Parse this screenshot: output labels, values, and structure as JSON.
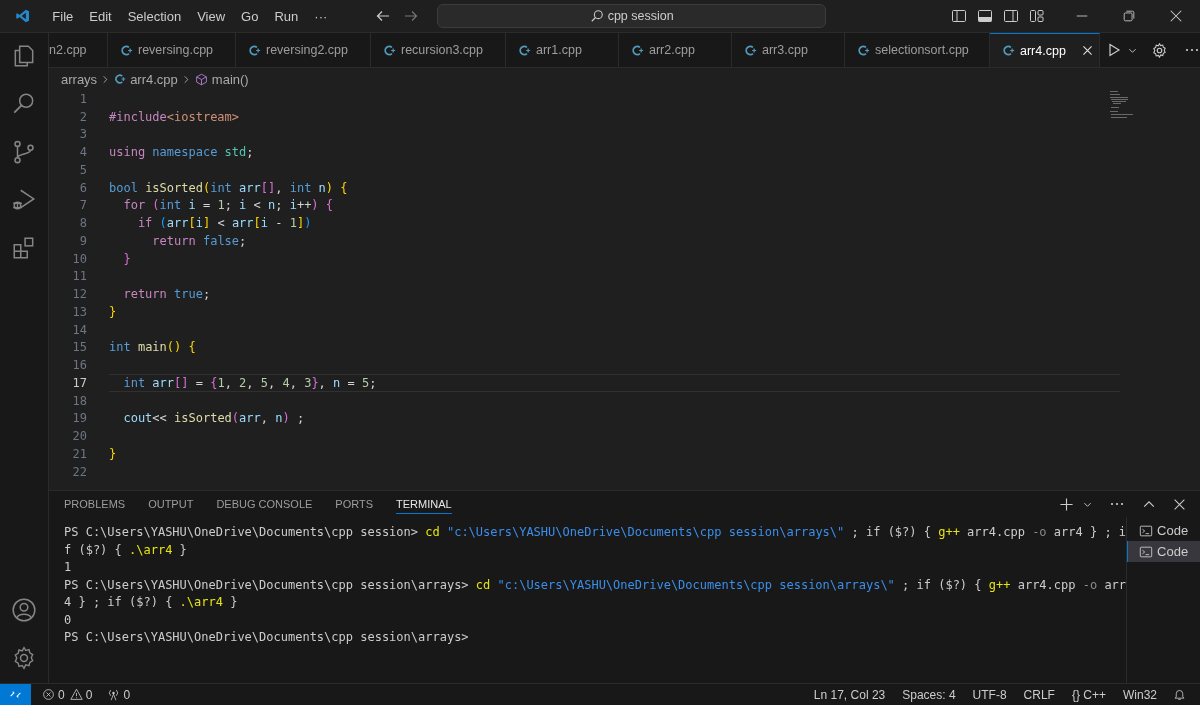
{
  "title_bar": {
    "menu": [
      "File",
      "Edit",
      "Selection",
      "View",
      "Go",
      "Run",
      "···"
    ],
    "search": "cpp session"
  },
  "tabs": [
    {
      "label": "n2.cpp",
      "selected": false
    },
    {
      "label": "reversing.cpp",
      "selected": false
    },
    {
      "label": "reversing2.cpp",
      "selected": false
    },
    {
      "label": "recursion3.cpp",
      "selected": false
    },
    {
      "label": "arr1.cpp",
      "selected": false
    },
    {
      "label": "arr2.cpp",
      "selected": false
    },
    {
      "label": "arr3.cpp",
      "selected": false
    },
    {
      "label": "selectionsort.cpp",
      "selected": false
    },
    {
      "label": "arr4.cpp",
      "selected": true
    }
  ],
  "breadcrumb": [
    "arrays",
    "arr4.cpp",
    "main()"
  ],
  "code_lines": [
    {
      "number": "1"
    },
    {
      "number": "2",
      "tokens": [
        {
          "text": "#include",
          "kind": "keyword"
        },
        {
          "text": "<iostream>",
          "kind": "string"
        }
      ]
    },
    {
      "number": "3"
    },
    {
      "number": "4",
      "tokens": [
        {
          "text": "using",
          "kind": "keyword"
        },
        {
          "text": " namespace",
          "kind": "type"
        },
        {
          "text": " std",
          "kind": "namespace"
        },
        {
          "text": ";",
          "kind": "plain"
        }
      ]
    },
    {
      "number": "5"
    },
    {
      "number": "6",
      "tokens": [
        {
          "text": "bool",
          "kind": "type"
        },
        {
          "text": " isSorted",
          "kind": "function"
        },
        {
          "text": "(",
          "kind": "bracket1"
        },
        {
          "text": "int",
          "kind": "type"
        },
        {
          "text": " arr",
          "kind": "variable"
        },
        {
          "text": "[]",
          "kind": "bracket2"
        },
        {
          "text": ",",
          "kind": "plain"
        },
        {
          "text": " int",
          "kind": "type"
        },
        {
          "text": " n",
          "kind": "variable"
        },
        {
          "text": ")",
          "kind": "bracket1"
        },
        {
          "text": " {",
          "kind": "bracket1"
        }
      ]
    },
    {
      "number": "7",
      "tokens": [
        {
          "text": "  for",
          "kind": "keyword"
        },
        {
          "text": " (",
          "kind": "bracket2"
        },
        {
          "text": "int",
          "kind": "type"
        },
        {
          "text": " i",
          "kind": "variable"
        },
        {
          "text": " =",
          "kind": "plain"
        },
        {
          "text": " 1",
          "kind": "number"
        },
        {
          "text": ";",
          "kind": "plain"
        },
        {
          "text": " i",
          "kind": "variable"
        },
        {
          "text": " <",
          "kind": "plain"
        },
        {
          "text": " n",
          "kind": "variable"
        },
        {
          "text": ";",
          "kind": "plain"
        },
        {
          "text": " i",
          "kind": "variable"
        },
        {
          "text": "++",
          "kind": "plain"
        },
        {
          "text": ")",
          "kind": "bracket2"
        },
        {
          "text": " {",
          "kind": "bracket2"
        }
      ]
    },
    {
      "number": "8",
      "tokens": [
        {
          "text": "    if",
          "kind": "keyword"
        },
        {
          "text": " (",
          "kind": "bracket3"
        },
        {
          "text": "arr",
          "kind": "variable"
        },
        {
          "text": "[",
          "kind": "bracket1"
        },
        {
          "text": "i",
          "kind": "variable"
        },
        {
          "text": "]",
          "kind": "bracket1"
        },
        {
          "text": " <",
          "kind": "plain"
        },
        {
          "text": " arr",
          "kind": "variable"
        },
        {
          "text": "[",
          "kind": "bracket1"
        },
        {
          "text": "i",
          "kind": "variable"
        },
        {
          "text": " -",
          "kind": "plain"
        },
        {
          "text": " 1",
          "kind": "number"
        },
        {
          "text": "]",
          "kind": "bracket1"
        },
        {
          "text": ")",
          "kind": "bracket3"
        }
      ]
    },
    {
      "number": "9",
      "tokens": [
        {
          "text": "      return",
          "kind": "keyword"
        },
        {
          "text": " false",
          "kind": "type"
        },
        {
          "text": ";",
          "kind": "plain"
        }
      ]
    },
    {
      "number": "10",
      "tokens": [
        {
          "text": "  }",
          "kind": "bracket2"
        }
      ]
    },
    {
      "number": "11"
    },
    {
      "number": "12",
      "tokens": [
        {
          "text": "  return",
          "kind": "keyword"
        },
        {
          "text": " true",
          "kind": "type"
        },
        {
          "text": ";",
          "kind": "plain"
        }
      ]
    },
    {
      "number": "13",
      "tokens": [
        {
          "text": "}",
          "kind": "bracket1"
        }
      ]
    },
    {
      "number": "14"
    },
    {
      "number": "15",
      "tokens": [
        {
          "text": "int",
          "kind": "type"
        },
        {
          "text": " main",
          "kind": "function"
        },
        {
          "text": "()",
          "kind": "bracket1"
        },
        {
          "text": " {",
          "kind": "bracket1"
        }
      ]
    },
    {
      "number": "16"
    },
    {
      "number": "17",
      "current": true,
      "tokens": [
        {
          "text": "  int",
          "kind": "type"
        },
        {
          "text": " arr",
          "kind": "variable"
        },
        {
          "text": "[]",
          "kind": "bracket2"
        },
        {
          "text": " =",
          "kind": "plain"
        },
        {
          "text": " {",
          "kind": "bracket2"
        },
        {
          "text": "1",
          "kind": "number"
        },
        {
          "text": ",",
          "kind": "plain"
        },
        {
          "text": " 2",
          "kind": "number"
        },
        {
          "text": ",",
          "kind": "plain"
        },
        {
          "text": " 5",
          "kind": "number"
        },
        {
          "text": ",",
          "kind": "plain"
        },
        {
          "text": " 4",
          "kind": "number"
        },
        {
          "text": ",",
          "kind": "plain"
        },
        {
          "text": " 3",
          "kind": "number"
        },
        {
          "text": "}",
          "kind": "bracket2"
        },
        {
          "text": ",",
          "kind": "plain"
        },
        {
          "text": " n",
          "kind": "variable"
        },
        {
          "text": " =",
          "kind": "plain"
        },
        {
          "text": " 5",
          "kind": "number"
        },
        {
          "text": ";",
          "kind": "plain"
        }
      ]
    },
    {
      "number": "18"
    },
    {
      "number": "19",
      "tokens": [
        {
          "text": "  cout",
          "kind": "variable"
        },
        {
          "text": "<<",
          "kind": "plain"
        },
        {
          "text": " isSorted",
          "kind": "function"
        },
        {
          "text": "(",
          "kind": "bracket2"
        },
        {
          "text": "arr",
          "kind": "variable"
        },
        {
          "text": ",",
          "kind": "plain"
        },
        {
          "text": " n",
          "kind": "variable"
        },
        {
          "text": ")",
          "kind": "bracket2"
        },
        {
          "text": " ;",
          "kind": "plain"
        }
      ]
    },
    {
      "number": "20"
    },
    {
      "number": "21",
      "tokens": [
        {
          "text": "}",
          "kind": "bracket1"
        }
      ]
    },
    {
      "number": "22"
    }
  ],
  "panel_tabs": [
    {
      "label": "PROBLEMS",
      "selected": false
    },
    {
      "label": "OUTPUT",
      "selected": false
    },
    {
      "label": "DEBUG CONSOLE",
      "selected": false
    },
    {
      "label": "PORTS",
      "selected": false
    },
    {
      "label": "TERMINAL",
      "selected": true
    }
  ],
  "terminal_lines": [
    [
      {
        "text": "PS C:\\Users\\YASHU\\OneDrive\\Documents\\cpp session>",
        "kind": "plain"
      },
      {
        "text": " cd",
        "kind": "command"
      },
      {
        "text": " \"c:\\Users\\YASHU\\OneDrive\\Documents\\cpp session\\arrays\\\"",
        "kind": "string"
      },
      {
        "text": " ; if ($?) {",
        "kind": "plain"
      },
      {
        "text": " g++",
        "kind": "command"
      },
      {
        "text": " arr4.cpp",
        "kind": "plain"
      },
      {
        "text": " -o",
        "kind": "flag"
      },
      {
        "text": " arr4 } ; i",
        "kind": "plain"
      }
    ],
    [
      {
        "text": "f ($?) {",
        "kind": "plain"
      },
      {
        "text": " .\\arr4",
        "kind": "command"
      },
      {
        "text": " }",
        "kind": "plain"
      }
    ],
    [
      {
        "text": "1",
        "kind": "plain"
      }
    ],
    [
      {
        "text": "PS C:\\Users\\YASHU\\OneDrive\\Documents\\cpp session\\arrays>",
        "kind": "plain"
      },
      {
        "text": " cd",
        "kind": "command"
      },
      {
        "text": " \"c:\\Users\\YASHU\\OneDrive\\Documents\\cpp session\\arrays\\\"",
        "kind": "string"
      },
      {
        "text": " ; if ($?) {",
        "kind": "plain"
      },
      {
        "text": " g++",
        "kind": "command"
      },
      {
        "text": " arr4.cpp",
        "kind": "plain"
      },
      {
        "text": " -o",
        "kind": "flag"
      },
      {
        "text": " arr",
        "kind": "plain"
      }
    ],
    [
      {
        "text": "4 } ; if ($?) {",
        "kind": "plain"
      },
      {
        "text": " .\\arr4",
        "kind": "command"
      },
      {
        "text": " }",
        "kind": "plain"
      }
    ],
    [
      {
        "text": "0",
        "kind": "plain"
      }
    ],
    [
      {
        "text": "PS C:\\Users\\YASHU\\OneDrive\\Documents\\cpp session\\arrays>",
        "kind": "plain"
      }
    ]
  ],
  "terminals": [
    {
      "label": "Code",
      "selected": false
    },
    {
      "label": "Code",
      "selected": true
    }
  ],
  "status_bar": {
    "errors": "0",
    "warnings": "0",
    "ports": "0",
    "right": [
      "Ln 17, Col 23",
      "Spaces: 4",
      "UTF-8",
      "CRLF",
      "{} C++",
      "Win32"
    ]
  }
}
